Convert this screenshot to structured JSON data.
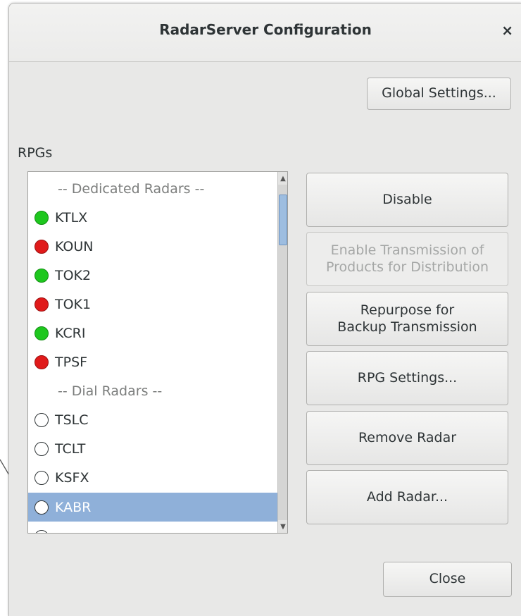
{
  "window": {
    "title": "RadarServer Configuration",
    "close_glyph": "×"
  },
  "buttons": {
    "global_settings": "Global Settings...",
    "disable": "Disable",
    "enable_transmission": "Enable Transmission of\nProducts for Distribution",
    "repurpose": "Repurpose for\nBackup Transmission",
    "rpg_settings": "RPG Settings...",
    "remove_radar": "Remove Radar",
    "add_radar": "Add Radar...",
    "close": "Close"
  },
  "rpgs": {
    "label": "RPGs",
    "dedicated_header": "-- Dedicated Radars --",
    "dial_header": "-- Dial Radars --",
    "items": [
      {
        "name": "KTLX",
        "status": "green"
      },
      {
        "name": "KOUN",
        "status": "red"
      },
      {
        "name": "TOK2",
        "status": "green"
      },
      {
        "name": "TOK1",
        "status": "red"
      },
      {
        "name": "KCRI",
        "status": "green"
      },
      {
        "name": "TPSF",
        "status": "red"
      },
      {
        "name": "TSLC",
        "status": "none"
      },
      {
        "name": "TCLT",
        "status": "none"
      },
      {
        "name": "KSFX",
        "status": "none"
      },
      {
        "name": "KABR",
        "status": "none",
        "selected": true
      }
    ]
  },
  "colors": {
    "green": "#1ec71e",
    "red": "#e01a1a",
    "selected": "#8fb0d9"
  }
}
